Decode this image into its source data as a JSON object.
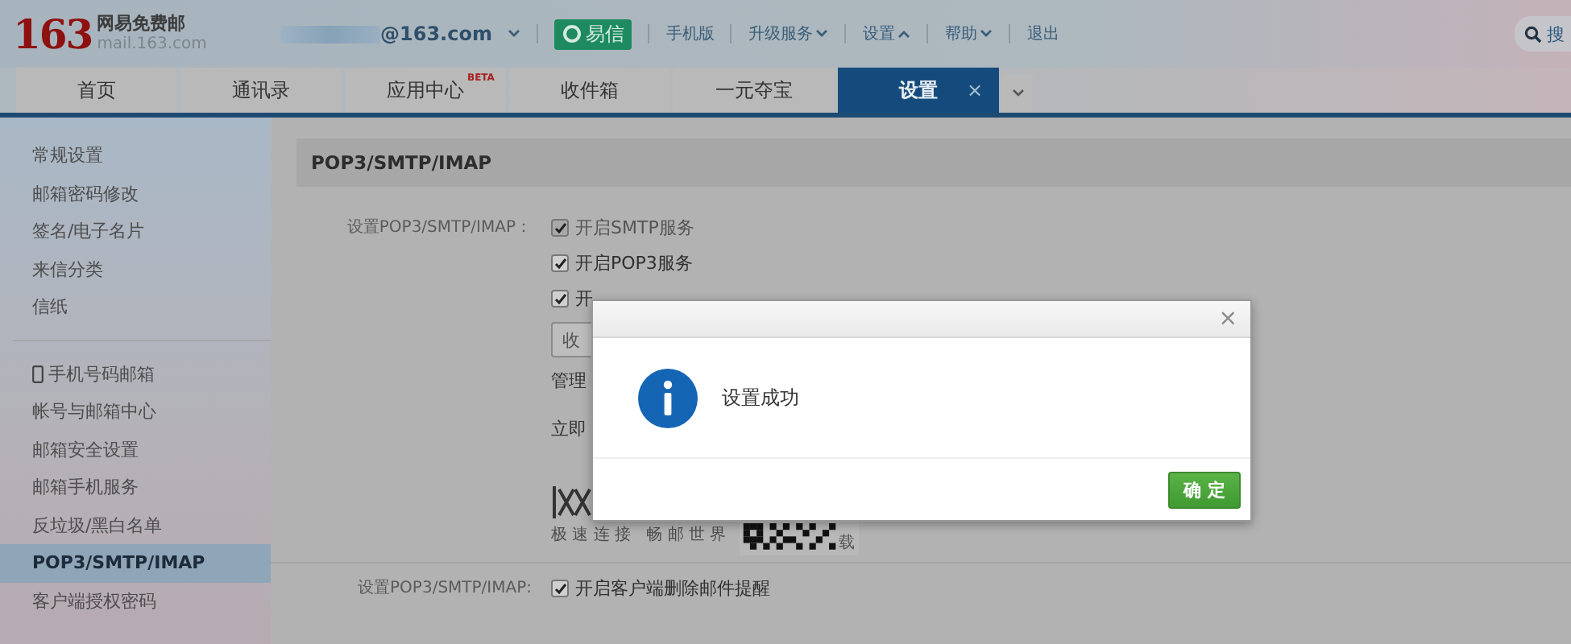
{
  "header": {
    "logo_number": "163",
    "logo_title": "网易免费邮",
    "logo_domain": "mail.163.com",
    "account": "@163.com",
    "yixin": "易信",
    "search": "搜",
    "links": [
      {
        "label": "手机版",
        "kind": "plain"
      },
      {
        "label": "升级服务",
        "kind": "menudown"
      },
      {
        "label": "设置",
        "kind": "menuup"
      },
      {
        "label": "帮助",
        "kind": "menudown"
      },
      {
        "label": "退出",
        "kind": "plain"
      }
    ]
  },
  "tabs": [
    {
      "label": "首页",
      "selected": false
    },
    {
      "label": "通讯录",
      "selected": false
    },
    {
      "label": "应用中心",
      "badge": "BETA",
      "selected": false
    },
    {
      "label": "收件箱",
      "selected": false
    },
    {
      "label": "一元夺宝",
      "selected": false
    },
    {
      "label": "设置",
      "selected": true,
      "close": "×"
    }
  ],
  "sidebar": {
    "groups": [
      [
        {
          "label": "常规设置",
          "kind": "text",
          "selected": false
        },
        {
          "label": "邮箱密码修改",
          "kind": "text",
          "selected": false
        },
        {
          "label": "签名/电子名片",
          "kind": "text",
          "selected": false
        },
        {
          "label": "来信分类",
          "kind": "text",
          "selected": false
        },
        {
          "label": "信纸",
          "kind": "text",
          "selected": false
        }
      ],
      [
        {
          "label": "手机号码邮箱",
          "kind": "phone",
          "selected": false
        },
        {
          "label": "帐号与邮箱中心",
          "kind": "text",
          "selected": false
        },
        {
          "label": "邮箱安全设置",
          "kind": "text",
          "selected": false
        },
        {
          "label": "邮箱手机服务",
          "kind": "text",
          "selected": false
        },
        {
          "label": "反垃圾/黑白名单",
          "kind": "text",
          "selected": false
        },
        {
          "label": "POP3/SMTP/IMAP",
          "kind": "text",
          "selected": true
        },
        {
          "label": "客户端授权密码",
          "kind": "text",
          "selected": false
        }
      ]
    ]
  },
  "content": {
    "section_title": "POP3/SMTP/IMAP",
    "setting_label": "设置POP3/SMTP/IMAP：",
    "checkboxes": [
      {
        "label": "开启SMTP服务",
        "checked": true,
        "disabled": true
      },
      {
        "label": "开启POP3服务",
        "checked": true,
        "disabled": false
      },
      {
        "label": "开",
        "checked": true,
        "disabled": false
      }
    ],
    "fetch_button": "收",
    "manage_text": "管理",
    "download_text": "立即",
    "slogan": "极 速 连 接   畅 邮 世 界",
    "download_label": "载",
    "second_label": "设置POP3/SMTP/IMAP:",
    "second_checkbox": {
      "label": "开启客户端删除邮件提醒",
      "checked": true,
      "disabled": false
    }
  },
  "dialog": {
    "message": "设置成功",
    "button": "确 定",
    "close": "×"
  }
}
